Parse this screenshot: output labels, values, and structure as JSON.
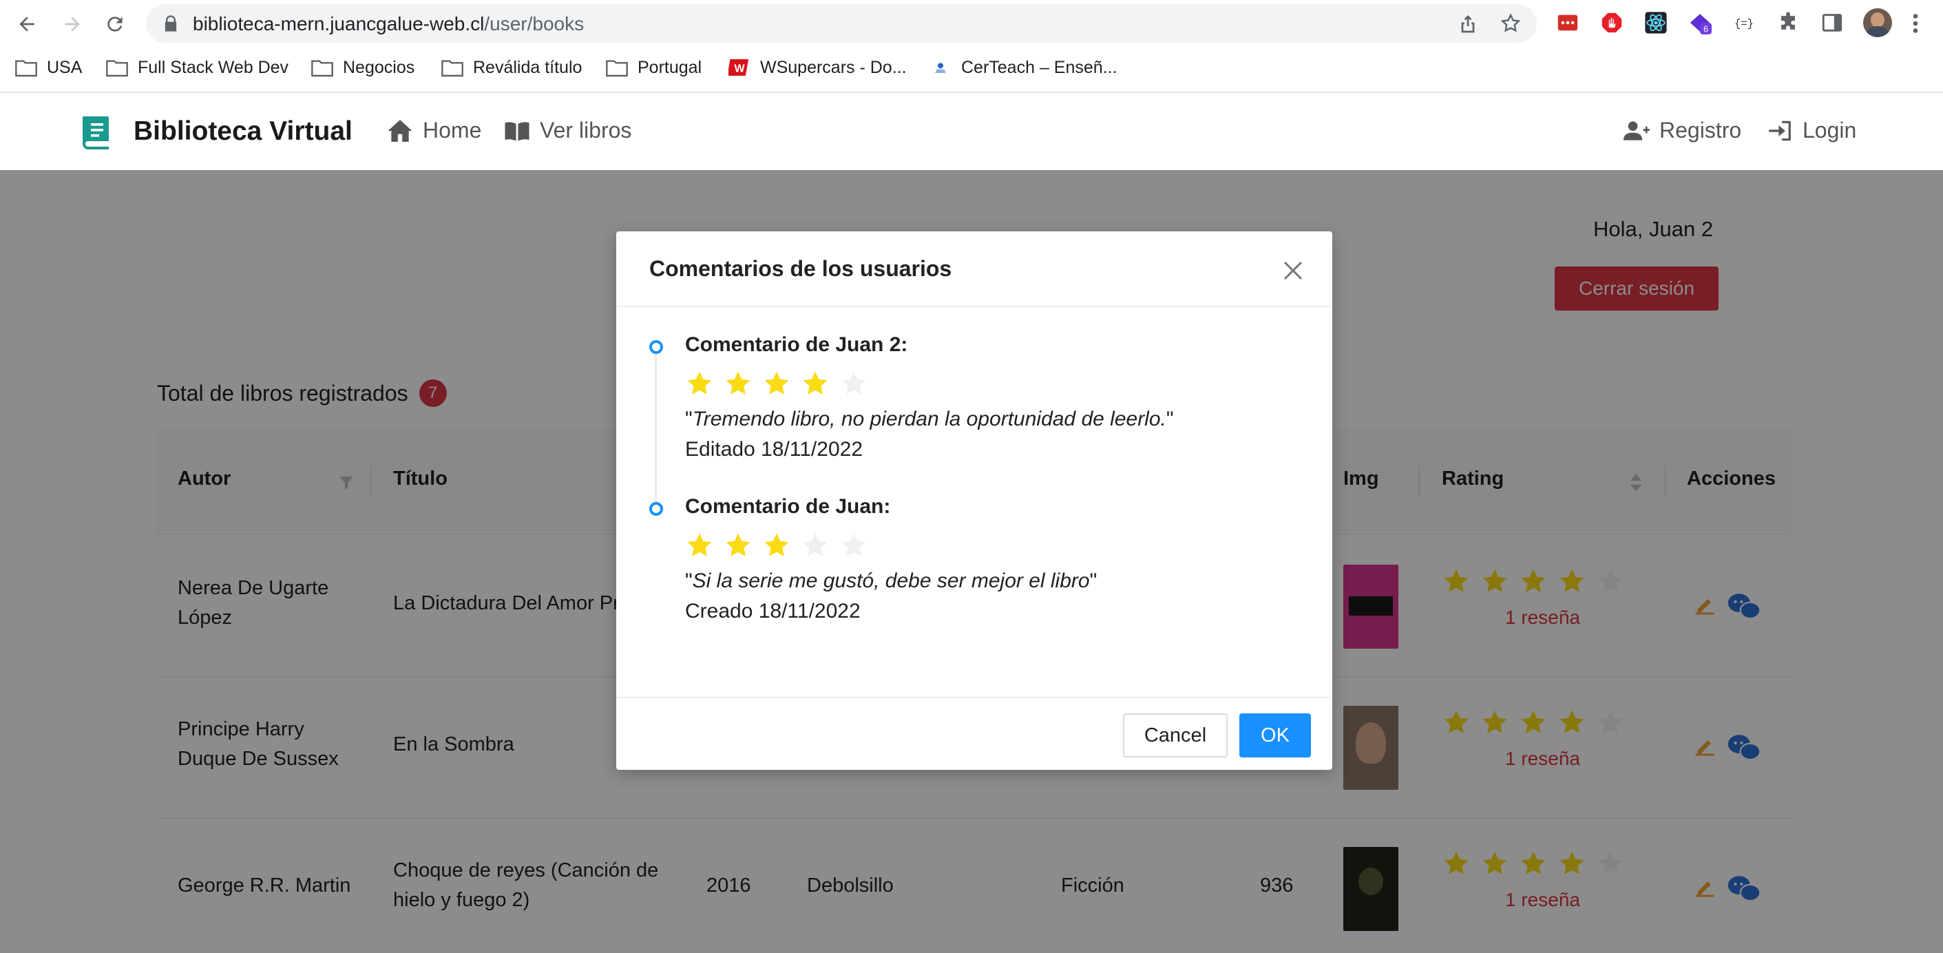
{
  "browser": {
    "url_host": "biblioteca-mern.juancgalue-web.cl",
    "url_path": "/user/books",
    "extension_badge": "6",
    "bookmarks": [
      {
        "label": "USA",
        "icon": "folder-icon"
      },
      {
        "label": "Full Stack Web Dev",
        "icon": "folder-icon"
      },
      {
        "label": "Negocios",
        "icon": "folder-icon"
      },
      {
        "label": "Reválida título",
        "icon": "folder-icon"
      },
      {
        "label": "Portugal",
        "icon": "folder-icon"
      },
      {
        "label": "WSupercars - Do...",
        "icon": "wsupercars-icon"
      },
      {
        "label": "CerTeach – Enseñ...",
        "icon": "certeach-icon"
      }
    ]
  },
  "header": {
    "brand": "Biblioteca Virtual",
    "nav": {
      "home": "Home",
      "books": "Ver libros"
    },
    "auth": {
      "register": "Registro",
      "login": "Login"
    }
  },
  "page": {
    "greeting": "Hola, Juan 2",
    "logout": "Cerrar sesión",
    "total_label": "Total de libros registrados",
    "total_count": "7"
  },
  "table": {
    "columns": {
      "author": "Autor",
      "title": "Título",
      "img": "Img",
      "rating": "Rating",
      "actions": "Acciones"
    },
    "rows": [
      {
        "author": "Nerea De Ugarte López",
        "title": "La Dictadura Del Amor Pr",
        "year": "",
        "publisher": "",
        "genre": "",
        "pages": "",
        "rating": 4,
        "reviews": "1 reseña",
        "cover_color": "#d9358f"
      },
      {
        "author": "Principe Harry Duque De Sussex",
        "title": "En la Sombra",
        "year": "",
        "publisher": "",
        "genre": "",
        "pages": "",
        "rating": 4,
        "reviews": "1 reseña",
        "cover_color": "#8a7566"
      },
      {
        "author": "George R.R. Martin",
        "title": "Choque de reyes (Canción de hielo y fuego 2)",
        "year": "2016",
        "publisher": "Debolsillo",
        "genre": "Ficción",
        "pages": "936",
        "rating": 4,
        "reviews": "1 reseña",
        "cover_color": "#1f2418"
      }
    ]
  },
  "modal": {
    "title": "Comentarios de los usuarios",
    "comments": [
      {
        "author": "Comentario de Juan 2:",
        "rating": 4,
        "text": "Tremendo libro, no pierdan la oportunidad de leerlo.",
        "date": "Editado 18/11/2022"
      },
      {
        "author": "Comentario de Juan:",
        "rating": 3,
        "text": "Si la serie me gustó, debe ser mejor el libro",
        "date": "Creado 18/11/2022"
      }
    ],
    "cancel": "Cancel",
    "ok": "OK"
  },
  "colors": {
    "brand_teal": "#1a9a8e",
    "danger": "#dc3545",
    "primary": "#1890ff",
    "star_filled": "#fadb14",
    "star_empty": "#f0f0f0",
    "edit_orange": "#f2a33a",
    "chat_blue": "#2f6fd6"
  }
}
